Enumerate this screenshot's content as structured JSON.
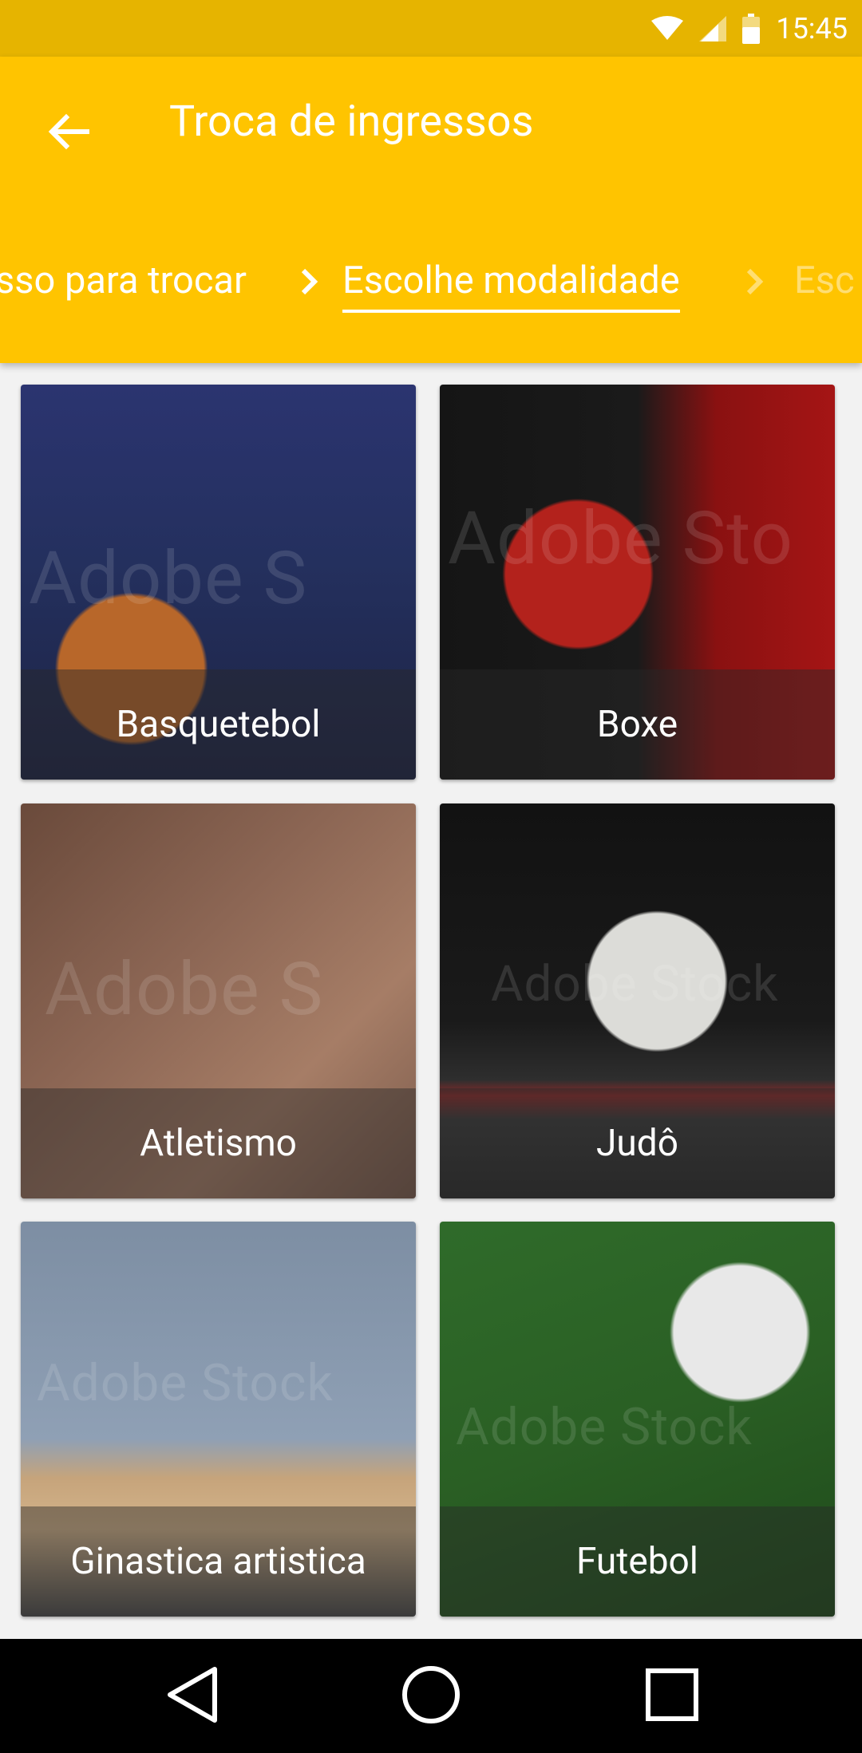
{
  "status_bar": {
    "time": "15:45",
    "icons": [
      "wifi-icon",
      "cell-signal-icon",
      "battery-icon"
    ]
  },
  "header": {
    "title": "Troca de ingressos",
    "back_icon": "arrow-back-icon",
    "steps": [
      {
        "label": "sso para trocar",
        "state": "previous"
      },
      {
        "label": "Escolhe modalidade",
        "state": "current"
      },
      {
        "label": "Esc",
        "state": "next"
      }
    ],
    "step_separator_icon": "chevron-right-icon"
  },
  "sports": [
    {
      "label": "Basquetebol",
      "watermark": "Adobe S"
    },
    {
      "label": "Boxe",
      "watermark": "Adobe Sto"
    },
    {
      "label": "Atletismo",
      "watermark": "Adobe S"
    },
    {
      "label": "Judô",
      "watermark": "Adobe Stock"
    },
    {
      "label": "Ginastica artistica",
      "watermark": "Adobe Stock"
    },
    {
      "label": "Futebol",
      "watermark": "Adobe Stock"
    }
  ],
  "nav_bar": {
    "buttons": [
      "back-triangle-icon",
      "home-circle-icon",
      "recents-square-icon"
    ]
  },
  "colors": {
    "primary": "#ffc400",
    "status_bar": "#e6b400",
    "background": "#f2f2f2"
  }
}
